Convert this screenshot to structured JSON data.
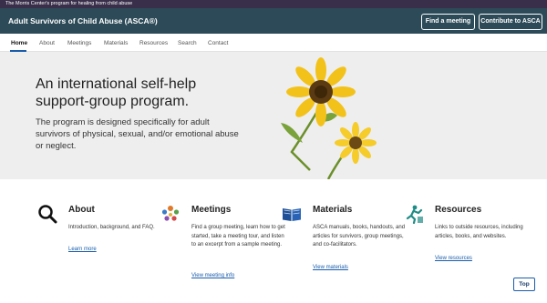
{
  "topbar": {
    "text": "The Morris Center's program for healing from child abuse"
  },
  "header": {
    "title": "Adult Survivors of Child Abuse  (ASCA®)",
    "find_button": "Find a meeting",
    "contribute_button": "Contribute to ASCA"
  },
  "nav": {
    "items": [
      "Home",
      "About",
      "Meetings",
      "Materials",
      "Resources",
      "Search",
      "Contact"
    ],
    "active": "Home"
  },
  "hero": {
    "title": "An international self-help support-group program.",
    "text": "The program is designed specifically for adult survivors of physical, sexual, and/or emotional abuse or neglect."
  },
  "cards": [
    {
      "icon": "magnifier-icon",
      "title": "About",
      "text": "Introduction, background, and FAQ.",
      "link": "Learn more"
    },
    {
      "icon": "group-icon",
      "title": "Meetings",
      "text": "Find a group meeting, learn how to get started, take a meeting tour, and listen to an excerpt from a sample meeting.",
      "link": "View meeting info"
    },
    {
      "icon": "book-icon",
      "title": "Materials",
      "text": "ASCA manuals, books, handouts, and articles for survivors, group meetings, and co-facilitators.",
      "link": "View materials"
    },
    {
      "icon": "climber-icon",
      "title": "Resources",
      "text": "Links to outside resources, including articles, books, and websites.",
      "link": "View resources"
    }
  ],
  "top_button": "Top",
  "colors": {
    "header": "#2c4a57",
    "topbar": "#3a2f4a",
    "link": "#1a5dab",
    "hero": "#eeeeee"
  }
}
